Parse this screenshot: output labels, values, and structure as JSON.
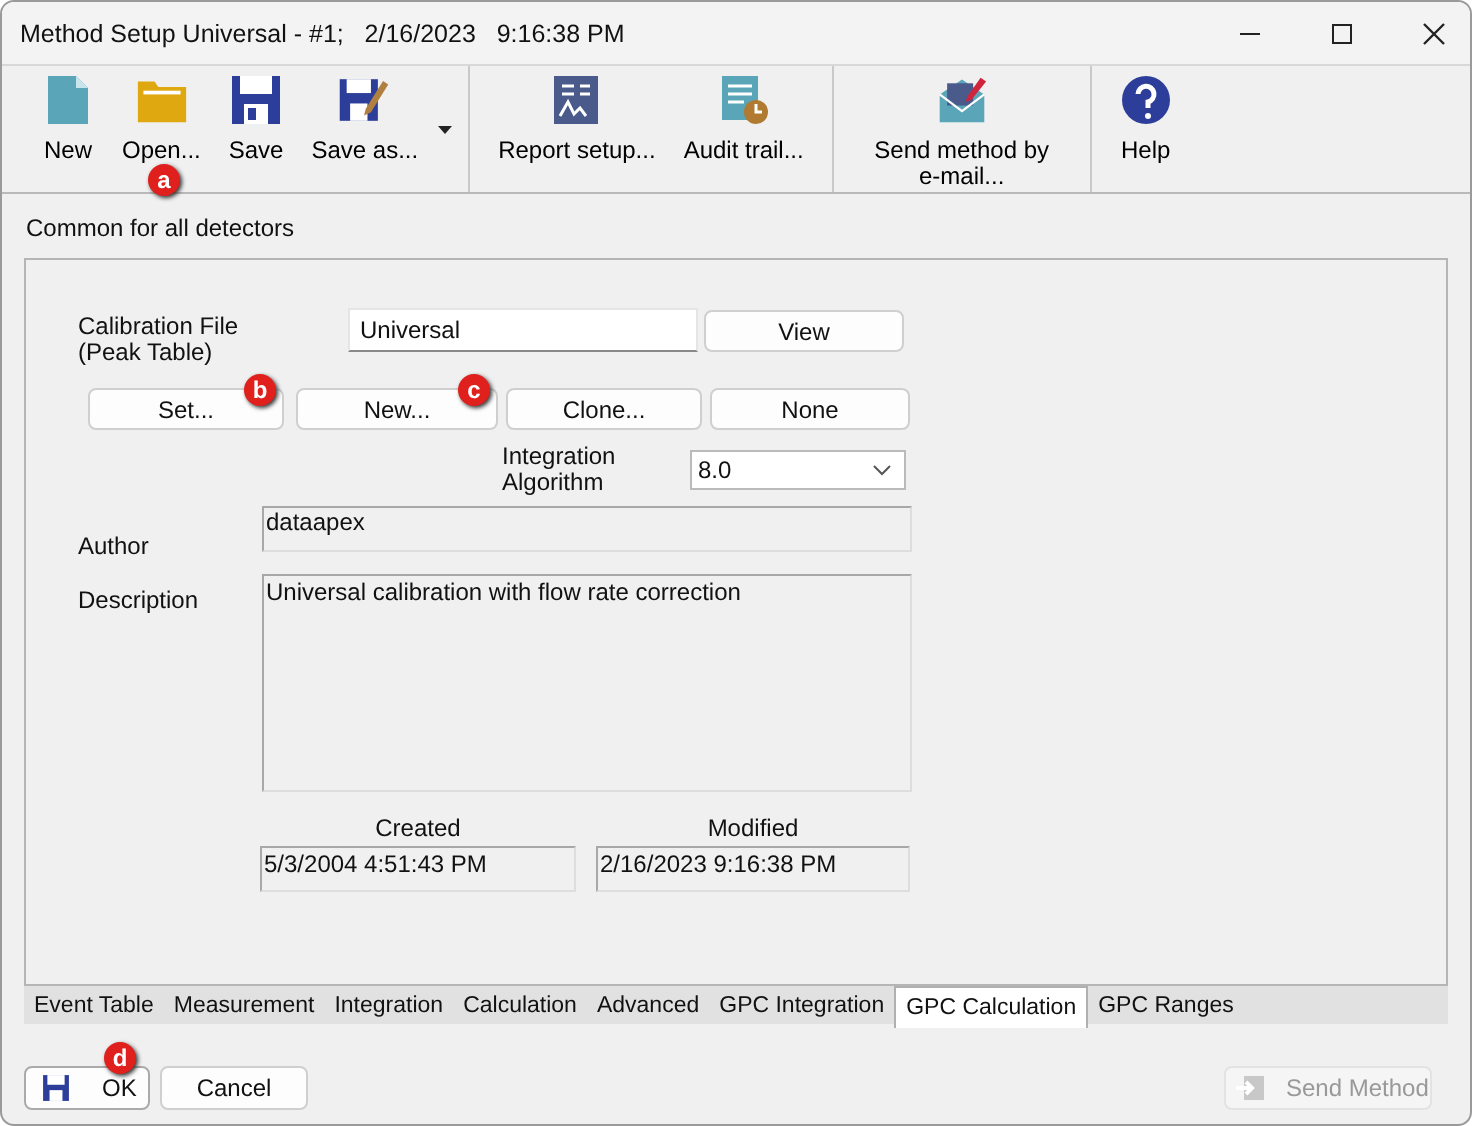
{
  "window": {
    "title": "Method Setup Universal - #1;   2/16/2023   9:16:38 PM"
  },
  "toolbar": {
    "groups": [
      {
        "items": [
          {
            "label": "New",
            "kind": "new"
          },
          {
            "label": "Open...",
            "kind": "open",
            "callout": "a"
          },
          {
            "label": "Save",
            "kind": "save"
          },
          {
            "label": "Save as...",
            "kind": "save_as",
            "dropdown": true
          }
        ]
      },
      {
        "items": [
          {
            "label": "Report setup...",
            "kind": "report"
          },
          {
            "label": "Audit trail...",
            "kind": "audit"
          }
        ]
      },
      {
        "items": [
          {
            "label": "Send method by e-mail...",
            "kind": "email"
          }
        ]
      },
      {
        "items": [
          {
            "label": "Help",
            "kind": "help"
          }
        ]
      }
    ]
  },
  "section_title": "Common for all detectors",
  "calibration": {
    "label": "Calibration File (Peak Table)",
    "value": "Universal",
    "view_button": "View",
    "buttons": [
      {
        "label": "Set...",
        "callout": "b"
      },
      {
        "label": "New...",
        "callout": "c"
      },
      {
        "label": "Clone..."
      },
      {
        "label": "None"
      }
    ]
  },
  "integration": {
    "label": "Integration Algorithm",
    "value": "8.0"
  },
  "author": {
    "label": "Author",
    "value": "dataapex"
  },
  "description": {
    "label": "Description",
    "value": "Universal calibration with flow rate correction"
  },
  "created": {
    "label": "Created",
    "value": "5/3/2004 4:51:43 PM"
  },
  "modified": {
    "label": "Modified",
    "value": "2/16/2023 9:16:38 PM"
  },
  "tabs": [
    {
      "label": "Event Table",
      "selected": false
    },
    {
      "label": "Measurement",
      "selected": false
    },
    {
      "label": "Integration",
      "selected": false
    },
    {
      "label": "Calculation",
      "selected": false
    },
    {
      "label": "Advanced",
      "selected": false
    },
    {
      "label": "GPC Integration",
      "selected": false
    },
    {
      "label": "GPC Calculation",
      "selected": true
    },
    {
      "label": "GPC Ranges",
      "selected": false
    }
  ],
  "footer": {
    "ok": {
      "label": "OK",
      "callout": "d"
    },
    "cancel": {
      "label": "Cancel"
    },
    "send": {
      "label": "Send Method",
      "disabled": true
    }
  }
}
